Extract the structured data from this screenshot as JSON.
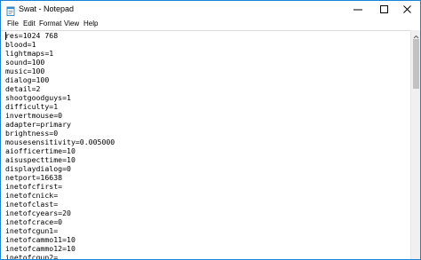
{
  "window": {
    "title": "Swat - Notepad",
    "icon": "notepad-icon",
    "controls": [
      "minimize-icon",
      "maximize-icon",
      "close-icon"
    ]
  },
  "menu": {
    "items": [
      {
        "label": "File"
      },
      {
        "label": "Edit"
      },
      {
        "label": "Format"
      },
      {
        "label": "View"
      },
      {
        "label": "Help"
      }
    ]
  },
  "editor": {
    "lines": [
      "res=1024 768",
      "blood=1",
      "lightmaps=1",
      "sound=100",
      "music=100",
      "dialog=100",
      "detail=2",
      "shootgoodguys=1",
      "difficulty=1",
      "invertmouse=0",
      "adapter=primary",
      "brightness=0",
      "mousesensitivity=0.005000",
      "aiofficertime=10",
      "aisuspecttime=10",
      "displaydialog=0",
      "netport=16638",
      "inetofcfirst=",
      "inetofcnick=",
      "inetofclast=",
      "inetofcyears=20",
      "inetofcrace=0",
      "inetofcgun1=",
      "inetofcammo11=10",
      "inetofcammo12=10",
      "inetofcgun2="
    ]
  }
}
